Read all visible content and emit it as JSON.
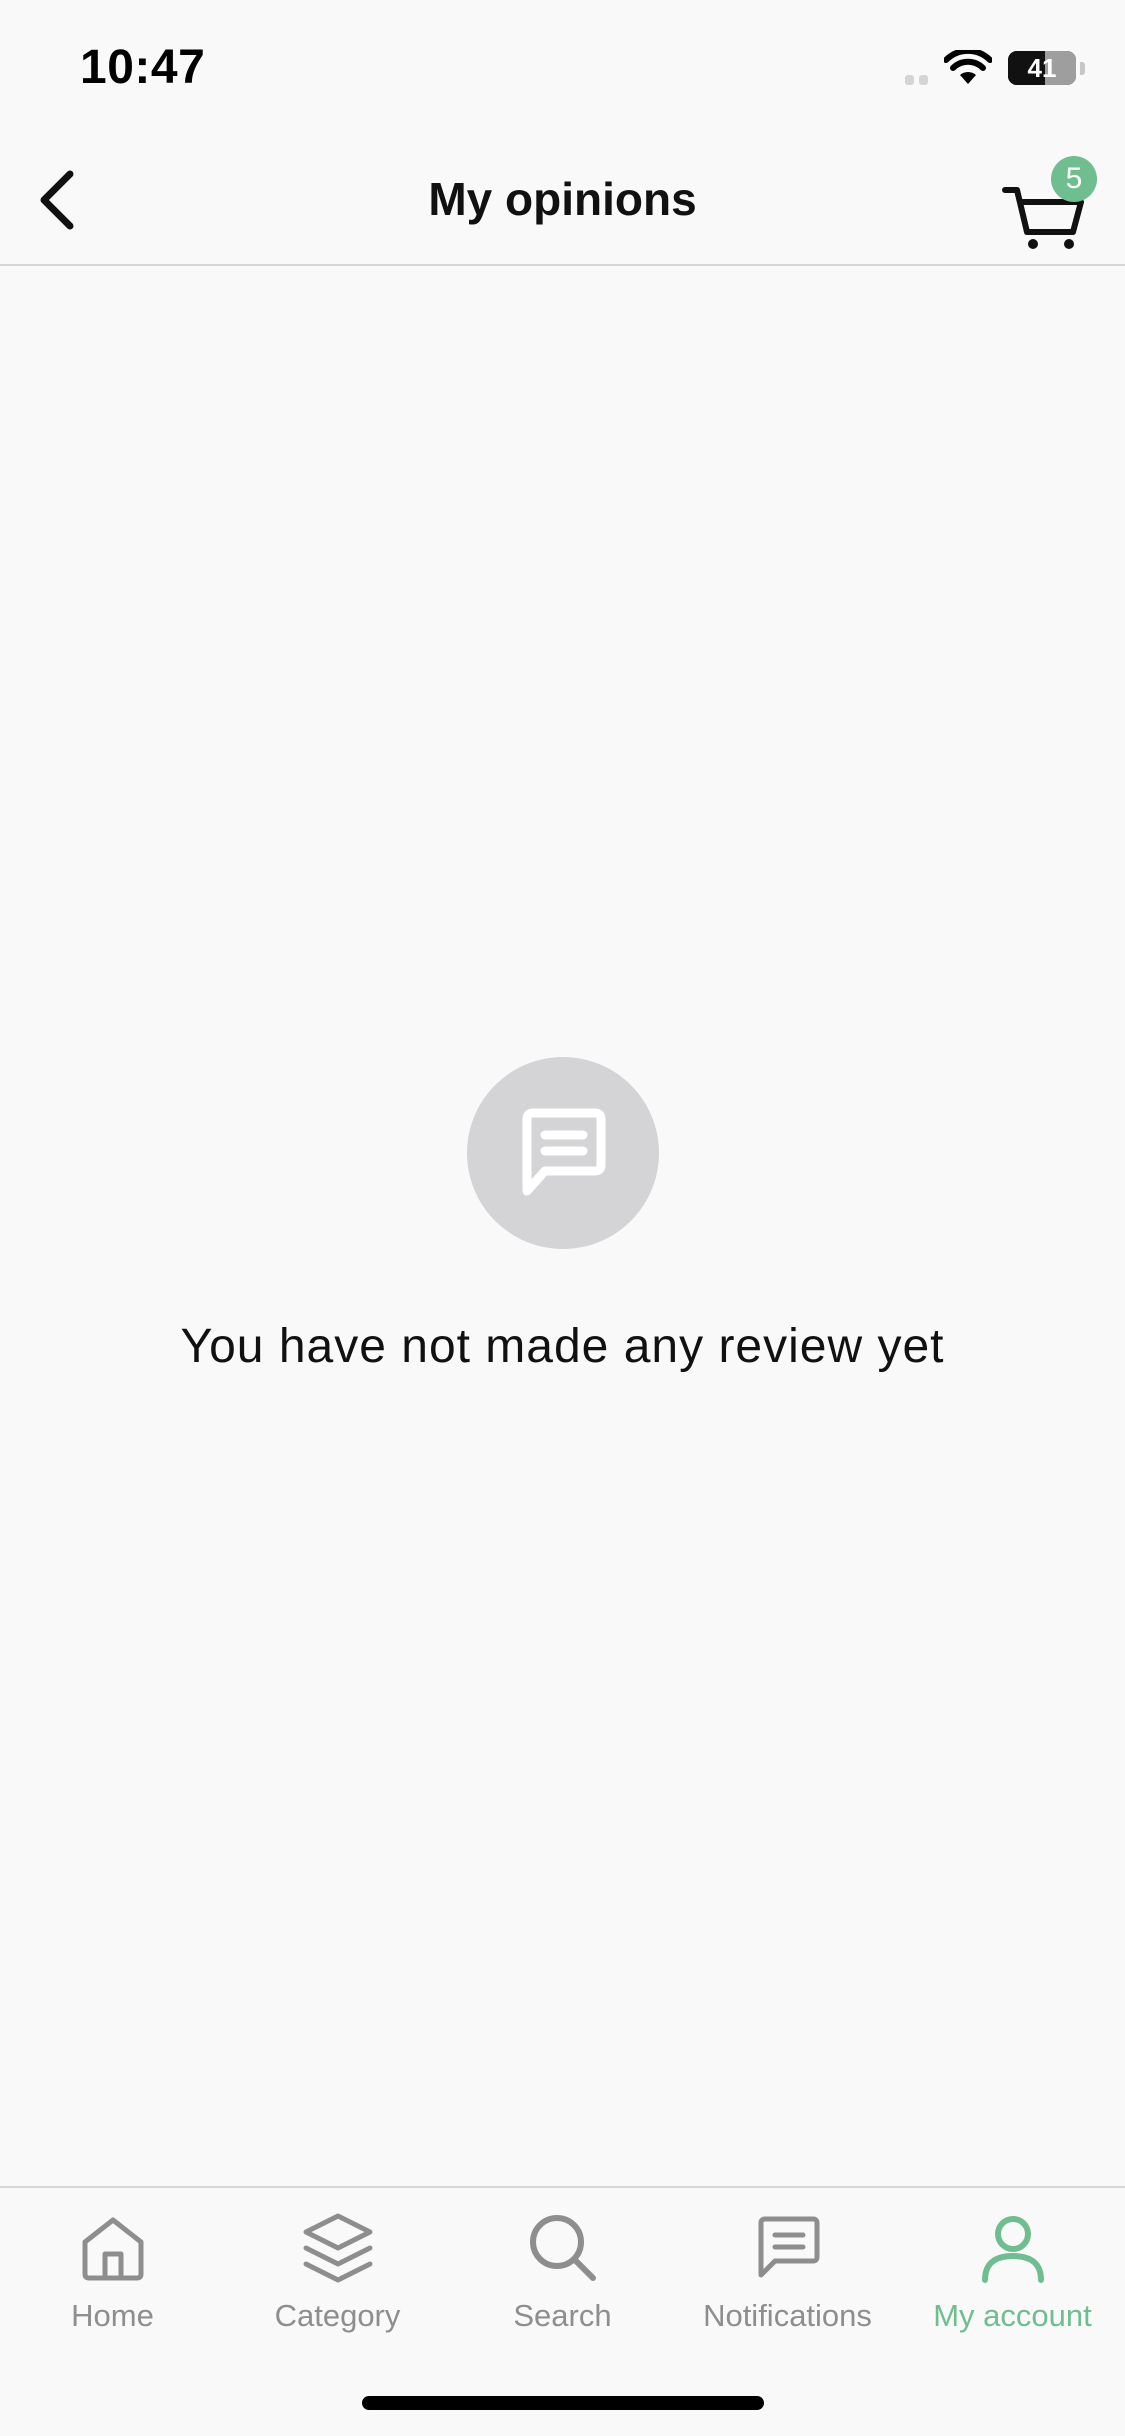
{
  "status_bar": {
    "time": "10:47",
    "battery": "41"
  },
  "header": {
    "title": "My opinions",
    "cart_count": "5"
  },
  "empty_state": {
    "icon": "chat-bubble-icon",
    "message": "You have not made any review yet"
  },
  "tabs": [
    {
      "label": "Home",
      "icon": "home-icon",
      "active": false
    },
    {
      "label": "Category",
      "icon": "layers-icon",
      "active": false
    },
    {
      "label": "Search",
      "icon": "search-icon",
      "active": false
    },
    {
      "label": "Notifications",
      "icon": "chat-bubble-icon",
      "active": false
    },
    {
      "label": "My account",
      "icon": "user-icon",
      "active": true
    }
  ],
  "colors": {
    "accent": "#6fbe8f",
    "inactive": "#8e8e8e",
    "background": "#f9f9f9",
    "empty_icon_bg": "#d4d4d7"
  }
}
